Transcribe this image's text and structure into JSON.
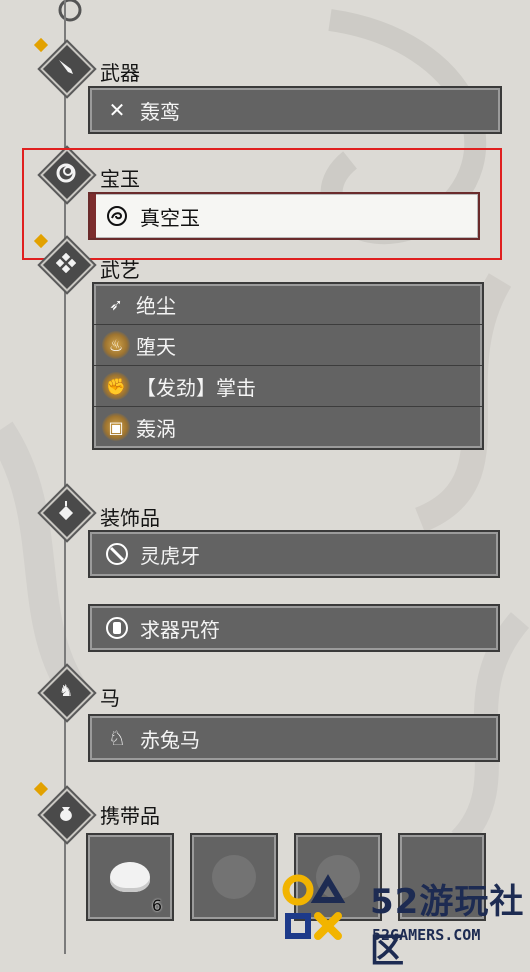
{
  "sections": {
    "weapon": {
      "title": "武器",
      "slot_label": "轰鸾",
      "node_icon": "sword-icon",
      "slot_icon": "crossed-axes-icon"
    },
    "gem": {
      "title": "宝玉",
      "slot_label": "真空玉",
      "node_icon": "ring-gem-icon",
      "slot_icon": "swirl-icon"
    },
    "martial": {
      "title": "武艺",
      "node_icon": "four-diamond-icon",
      "skills": [
        {
          "label": "绝尘",
          "icon": "dash-icon"
        },
        {
          "label": "堕天",
          "icon": "flame-icon"
        },
        {
          "label": "【发劲】掌击",
          "icon": "fist-icon"
        },
        {
          "label": "轰涡",
          "icon": "vortex-icon"
        }
      ]
    },
    "accessory": {
      "title": "装饰品",
      "node_icon": "amulet-icon",
      "slots": [
        {
          "label": "灵虎牙",
          "icon": "fang-icon"
        },
        {
          "label": "求器咒符",
          "icon": "talisman-icon"
        }
      ]
    },
    "horse": {
      "title": "马",
      "slot_label": "赤兔马",
      "node_icon": "horse-icon",
      "slot_icon": "horse-head-icon"
    },
    "carry": {
      "title": "携带品",
      "node_icon": "pouch-icon",
      "items": [
        {
          "name": "bun",
          "count": "6"
        },
        {
          "name": "empty-1",
          "count": ""
        },
        {
          "name": "empty-2",
          "count": ""
        },
        {
          "name": "empty-3",
          "count": ""
        }
      ]
    }
  },
  "watermark": {
    "main": "52游玩社区",
    "sub": "52GAMERS.COM"
  },
  "colors": {
    "highlight": "#e02020",
    "pip": "#e2a100",
    "slot_bg": "#636363",
    "selected_bg": "#f6f6f3"
  }
}
